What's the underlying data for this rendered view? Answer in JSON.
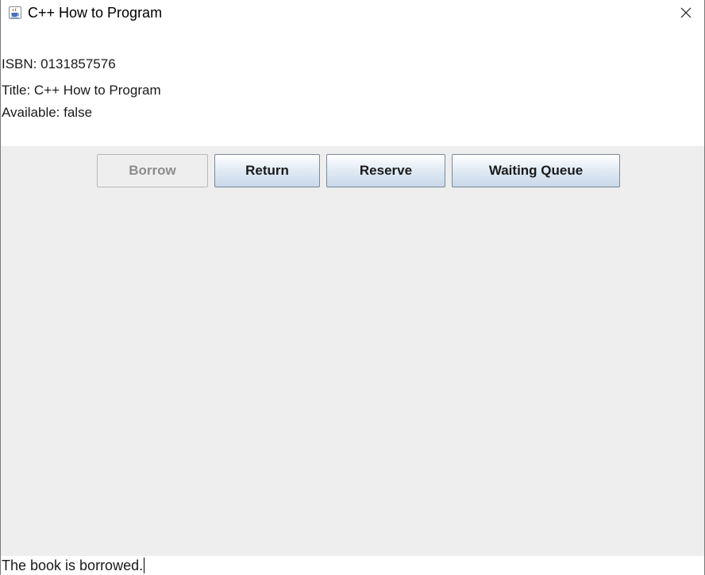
{
  "window": {
    "title": "C++ How to Program"
  },
  "book": {
    "isbn_line": "ISBN: 0131857576",
    "title_line": "Title: C++ How to Program",
    "available_line": "Available: false"
  },
  "buttons": {
    "borrow": {
      "label": "Borrow",
      "enabled": false
    },
    "return": {
      "label": "Return",
      "enabled": true
    },
    "reserve": {
      "label": "Reserve",
      "enabled": true
    },
    "waiting_queue": {
      "label": "Waiting Queue",
      "enabled": true
    }
  },
  "status": {
    "message": "The book is borrowed."
  },
  "icons": {
    "app": "java-cup-icon",
    "close": "close-icon"
  },
  "colors": {
    "panel_background": "#eeeeee",
    "button_gradient_top": "#ffffff",
    "button_gradient_bottom": "#c9d8e8",
    "disabled_text": "#8d8d8d"
  }
}
